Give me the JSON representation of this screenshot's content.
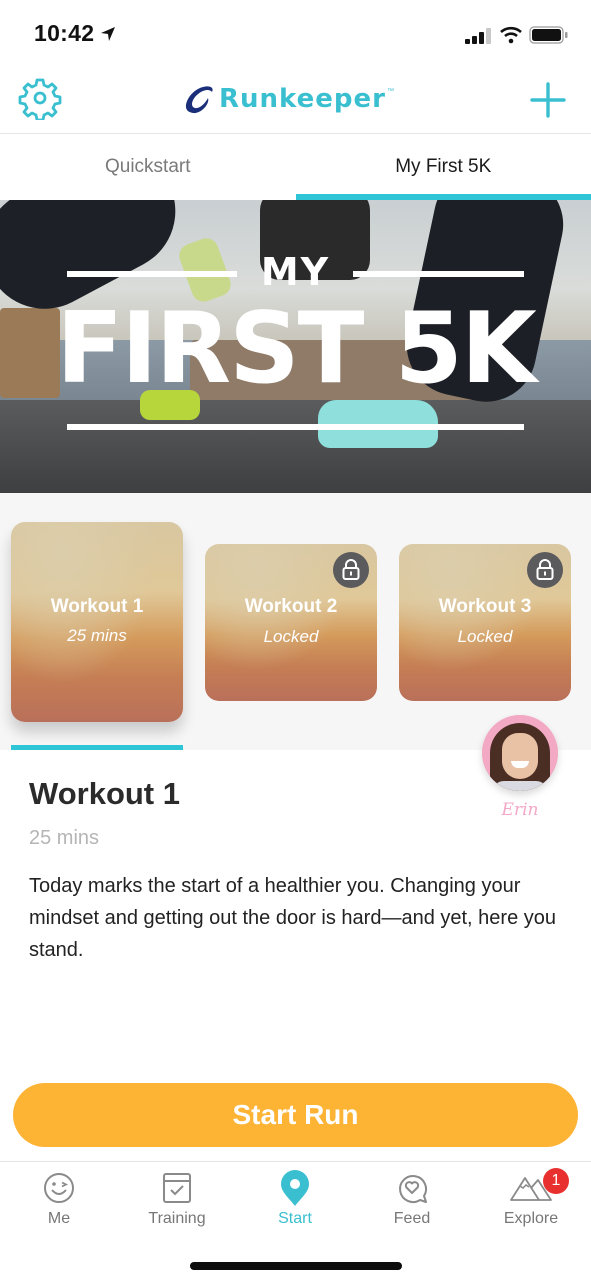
{
  "status_bar": {
    "time": "10:42",
    "location_icon": "location-arrow-icon",
    "signal_icon": "cellular-signal-icon",
    "wifi_icon": "wifi-icon",
    "battery_icon": "battery-icon"
  },
  "header": {
    "settings_icon": "gear-icon",
    "logo_text": "Runkeeper",
    "logo_tm": "™",
    "add_icon": "plus-icon",
    "brand_color": "#39bfd0"
  },
  "tabs": [
    {
      "label": "Quickstart",
      "active": false
    },
    {
      "label": "My First 5K",
      "active": true
    }
  ],
  "hero": {
    "kicker": "MY",
    "title": "FIRST 5K"
  },
  "workouts": [
    {
      "title": "Workout 1",
      "subtitle": "25 mins",
      "locked": false,
      "selected": true
    },
    {
      "title": "Workout 2",
      "subtitle": "Locked",
      "locked": true,
      "selected": false
    },
    {
      "title": "Workout 3",
      "subtitle": "Locked",
      "locked": true,
      "selected": false
    }
  ],
  "coach": {
    "name": "Erin"
  },
  "detail": {
    "title": "Workout 1",
    "duration": "25 mins",
    "description": "Today marks the start of a healthier you. Changing your mindset and getting out the door is hard—and yet, here you stand."
  },
  "start_button": {
    "label": "Start Run",
    "color": "#fdb334"
  },
  "bottom_nav": {
    "items": [
      {
        "label": "Me",
        "icon": "winking-face-icon",
        "active": false
      },
      {
        "label": "Training",
        "icon": "calendar-check-icon",
        "active": false
      },
      {
        "label": "Start",
        "icon": "map-pin-icon",
        "active": true
      },
      {
        "label": "Feed",
        "icon": "heart-chat-icon",
        "active": false
      },
      {
        "label": "Explore",
        "icon": "mountains-icon",
        "active": false,
        "badge": "1"
      }
    ],
    "accent_color": "#39bfd0",
    "badge_color": "#e8312f"
  }
}
